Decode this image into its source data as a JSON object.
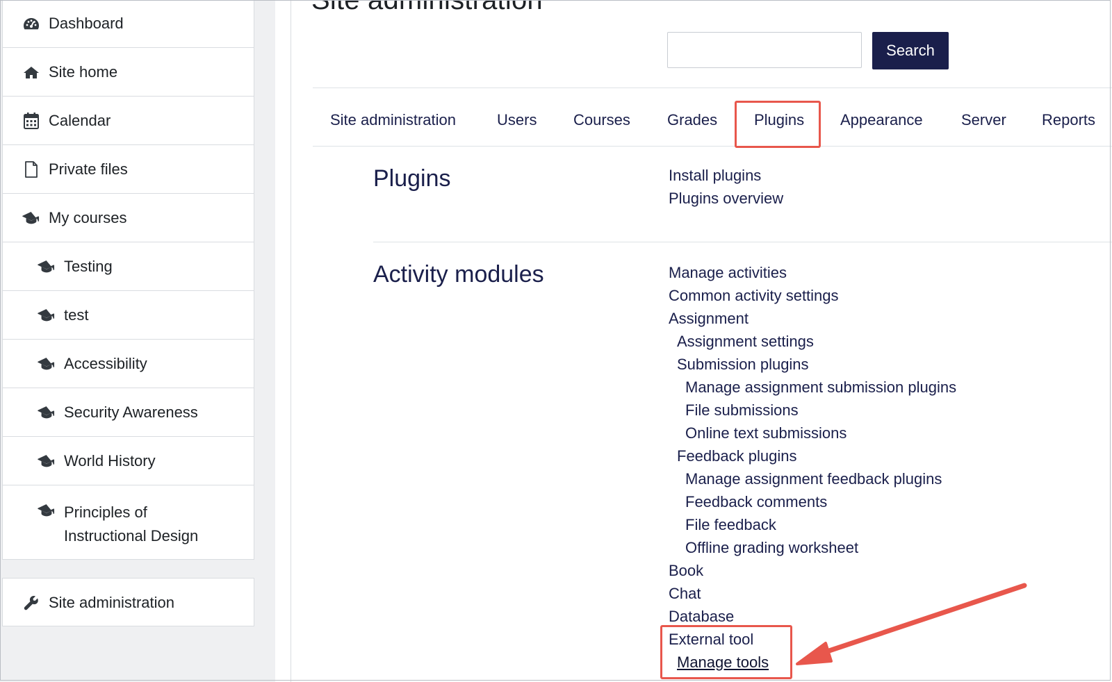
{
  "sidebar": {
    "items": [
      {
        "label": "Dashboard",
        "icon": "dashboard-icon"
      },
      {
        "label": "Site home",
        "icon": "home-icon"
      },
      {
        "label": "Calendar",
        "icon": "calendar-icon"
      },
      {
        "label": "Private files",
        "icon": "file-icon"
      },
      {
        "label": "My courses",
        "icon": "graduation-cap-icon"
      }
    ],
    "courses": [
      {
        "label": "Testing"
      },
      {
        "label": "test"
      },
      {
        "label": "Accessibility"
      },
      {
        "label": "Security Awareness"
      },
      {
        "label": "World History"
      },
      {
        "label": "Principles of Instructional Design"
      }
    ],
    "admin": {
      "label": "Site administration",
      "icon": "wrench-icon"
    }
  },
  "header": {
    "title": "Site administration",
    "search": {
      "value": "",
      "placeholder": "",
      "button_label": "Search"
    }
  },
  "tabs": [
    {
      "label": "Site administration"
    },
    {
      "label": "Users"
    },
    {
      "label": "Courses"
    },
    {
      "label": "Grades"
    },
    {
      "label": "Plugins",
      "highlighted": true
    },
    {
      "label": "Appearance"
    },
    {
      "label": "Server"
    },
    {
      "label": "Reports"
    }
  ],
  "sections": {
    "plugins": {
      "title": "Plugins",
      "links": [
        "Install plugins",
        "Plugins overview"
      ]
    },
    "activity_modules": {
      "title": "Activity modules",
      "links": {
        "manage_activities": "Manage activities",
        "common_settings": "Common activity settings",
        "assignment": "Assignment",
        "assignment_settings": "Assignment settings",
        "submission_plugins": "Submission plugins",
        "manage_submission": "Manage assignment submission plugins",
        "file_submissions": "File submissions",
        "online_text": "Online text submissions",
        "feedback_plugins": "Feedback plugins",
        "manage_feedback": "Manage assignment feedback plugins",
        "feedback_comments": "Feedback comments",
        "file_feedback": "File feedback",
        "offline_grading": "Offline grading worksheet",
        "book": "Book",
        "chat": "Chat",
        "database": "Database",
        "external_tool": "External tool",
        "manage_tools": "Manage tools"
      }
    }
  },
  "colors": {
    "accent": "#1a1f4b",
    "highlight": "#e8574c",
    "sidebar_bg": "#eff0f2"
  }
}
